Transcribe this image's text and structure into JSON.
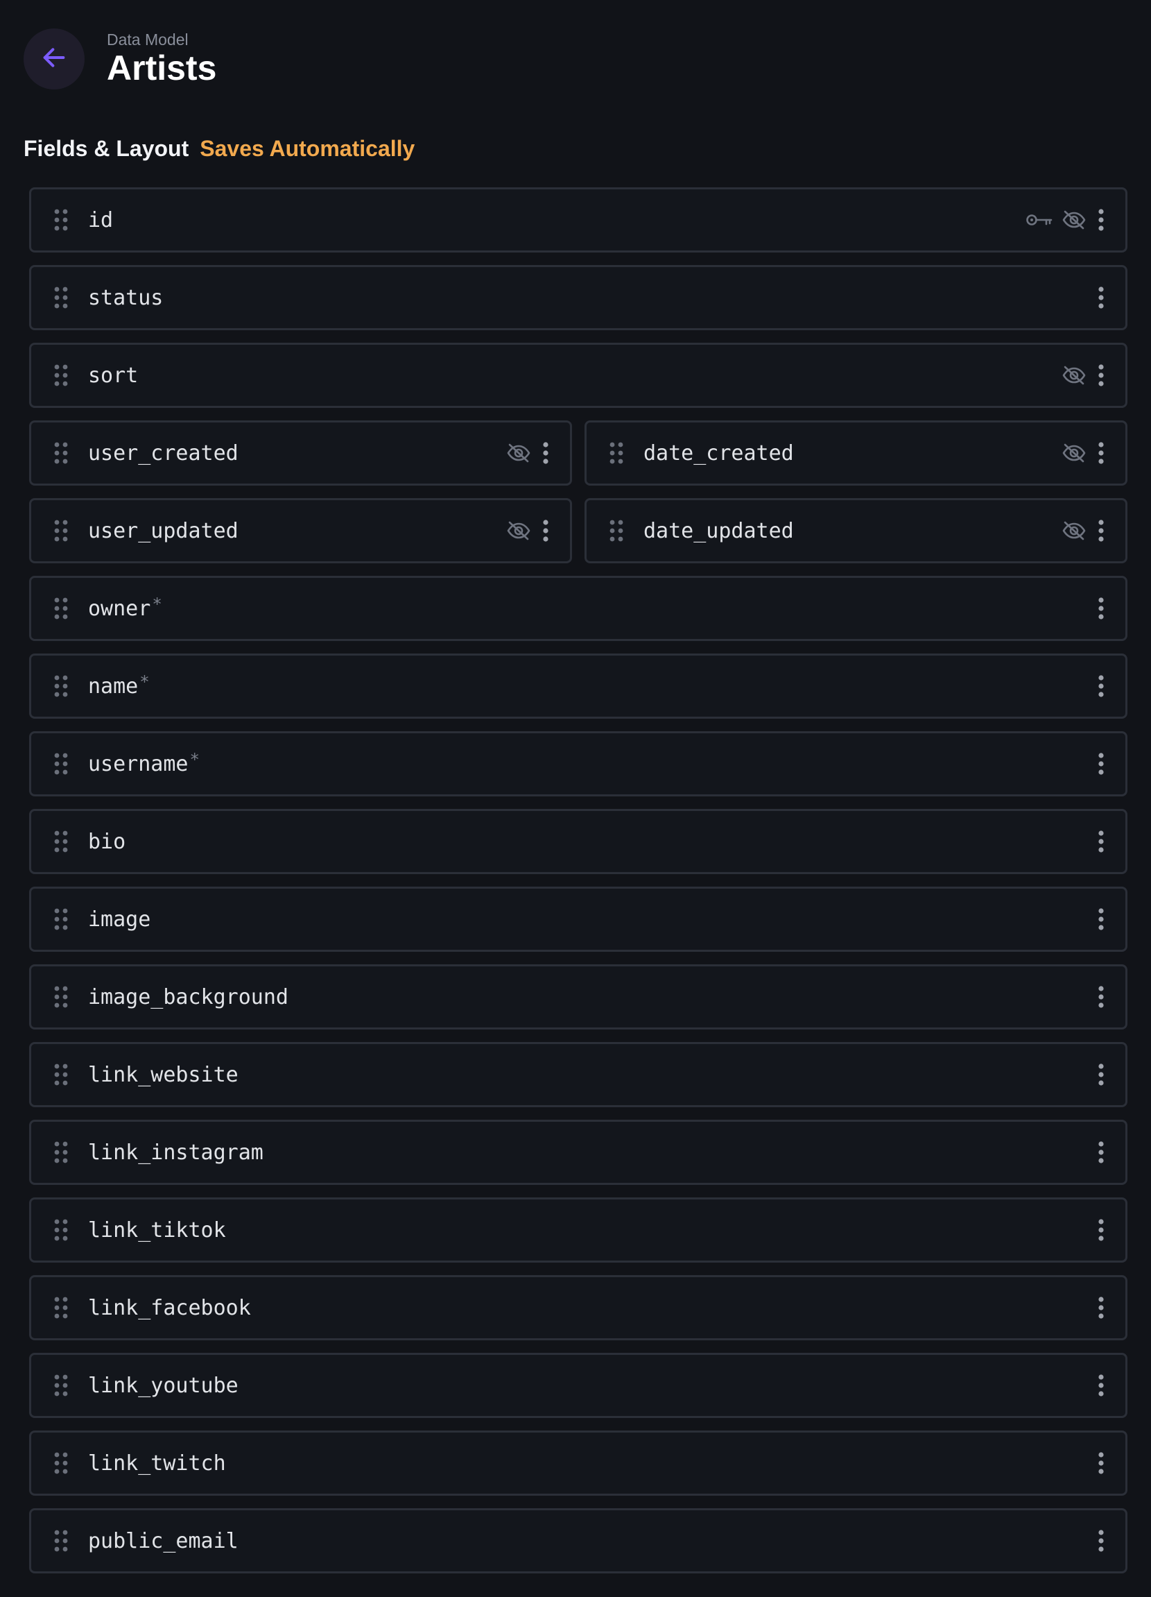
{
  "header": {
    "kicker": "Data Model",
    "title": "Artists",
    "back_icon": "arrow-left-icon"
  },
  "section": {
    "title": "Fields & Layout",
    "note": "Saves Automatically"
  },
  "colors": {
    "background": "#111318",
    "accent": "#7c5cff",
    "note": "#f2a94e",
    "border": "#2b2f38"
  },
  "fields": [
    {
      "name": "id",
      "width": "full",
      "required": false,
      "icons": [
        "key-icon",
        "hidden-icon"
      ]
    },
    {
      "name": "status",
      "width": "full",
      "required": false,
      "icons": []
    },
    {
      "name": "sort",
      "width": "full",
      "required": false,
      "icons": [
        "hidden-icon"
      ]
    },
    {
      "name": "user_created",
      "width": "half",
      "required": false,
      "icons": [
        "hidden-icon"
      ]
    },
    {
      "name": "date_created",
      "width": "half",
      "required": false,
      "icons": [
        "hidden-icon"
      ]
    },
    {
      "name": "user_updated",
      "width": "half",
      "required": false,
      "icons": [
        "hidden-icon"
      ]
    },
    {
      "name": "date_updated",
      "width": "half",
      "required": false,
      "icons": [
        "hidden-icon"
      ]
    },
    {
      "name": "owner",
      "width": "full",
      "required": true,
      "icons": []
    },
    {
      "name": "name",
      "width": "full",
      "required": true,
      "icons": []
    },
    {
      "name": "username",
      "width": "full",
      "required": true,
      "icons": []
    },
    {
      "name": "bio",
      "width": "full",
      "required": false,
      "icons": []
    },
    {
      "name": "image",
      "width": "full",
      "required": false,
      "icons": []
    },
    {
      "name": "image_background",
      "width": "full",
      "required": false,
      "icons": []
    },
    {
      "name": "link_website",
      "width": "full",
      "required": false,
      "icons": []
    },
    {
      "name": "link_instagram",
      "width": "full",
      "required": false,
      "icons": []
    },
    {
      "name": "link_tiktok",
      "width": "full",
      "required": false,
      "icons": []
    },
    {
      "name": "link_facebook",
      "width": "full",
      "required": false,
      "icons": []
    },
    {
      "name": "link_youtube",
      "width": "full",
      "required": false,
      "icons": []
    },
    {
      "name": "link_twitch",
      "width": "full",
      "required": false,
      "icons": []
    },
    {
      "name": "public_email",
      "width": "full",
      "required": false,
      "icons": []
    }
  ],
  "required_marker": "*"
}
